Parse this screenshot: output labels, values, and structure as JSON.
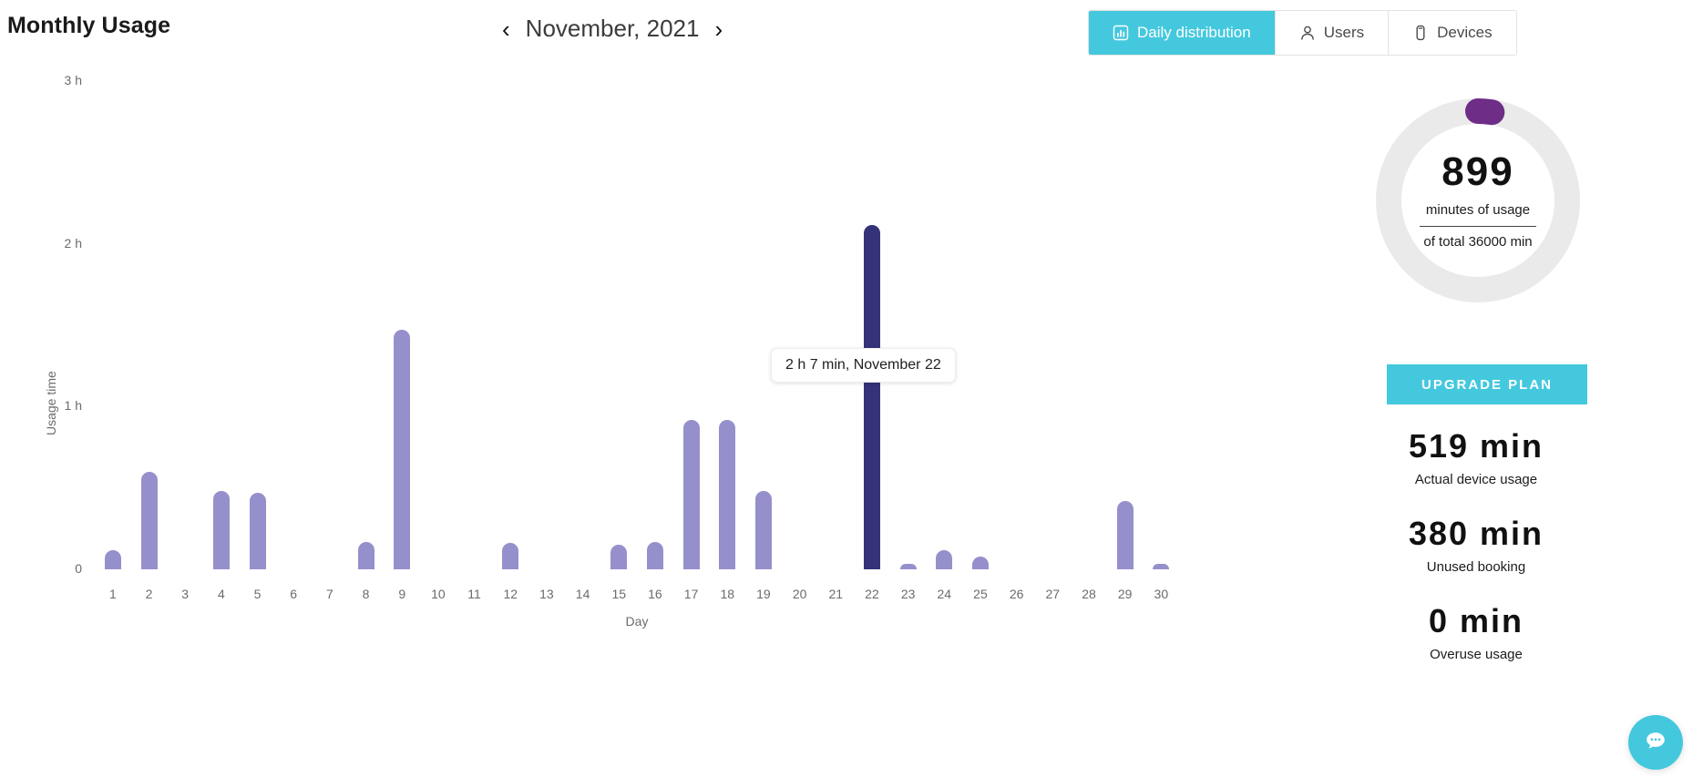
{
  "header": {
    "title": "Monthly Usage",
    "prev_label": "‹",
    "next_label": "›",
    "month": "November, 2021"
  },
  "tabs": [
    {
      "label": "Daily distribution",
      "icon": "bar-chart-icon",
      "active": true
    },
    {
      "label": "Users",
      "icon": "user-icon",
      "active": false
    },
    {
      "label": "Devices",
      "icon": "device-icon",
      "active": false
    }
  ],
  "tooltip": {
    "text": "2 h 7 min, November 22"
  },
  "summary": {
    "value": "899",
    "value_caption": "minutes of usage",
    "total_caption": "of total 36000 min",
    "upgrade_label": "UPGRADE PLAN",
    "stats": [
      {
        "value": "519 min",
        "caption": "Actual device usage"
      },
      {
        "value": "380 min",
        "caption": "Unused booking"
      },
      {
        "value": "0 min",
        "caption": "Overuse usage"
      }
    ]
  },
  "fab": {
    "icon": "chat-bubble-icon"
  },
  "colors": {
    "accent": "#44c8dd",
    "bar": "#9590cb",
    "bar_selected": "#343278",
    "donut_arc": "#6e2d87",
    "donut_track": "#eaeaea"
  },
  "chart_data": {
    "type": "bar",
    "title": "Monthly Usage",
    "xlabel": "Day",
    "ylabel": "Usage time",
    "categories": [
      "1",
      "2",
      "3",
      "4",
      "5",
      "6",
      "7",
      "8",
      "9",
      "10",
      "11",
      "12",
      "13",
      "14",
      "15",
      "16",
      "17",
      "18",
      "19",
      "20",
      "21",
      "22",
      "23",
      "24",
      "25",
      "26",
      "27",
      "28",
      "29",
      "30"
    ],
    "values": [
      0.12,
      0.6,
      0,
      0.48,
      0.47,
      0,
      0,
      0.17,
      1.47,
      0,
      0,
      0.16,
      0,
      0,
      0.15,
      0.17,
      0.92,
      0.92,
      0.48,
      0,
      0,
      2.117,
      0.03,
      0.12,
      0.08,
      0,
      0,
      0,
      0.42,
      0.02
    ],
    "selected_index": 21,
    "unit": "hours",
    "ylim": [
      0,
      3.05
    ],
    "yticks": [
      0,
      1,
      2,
      3
    ],
    "ytick_labels": [
      "0",
      "1 h",
      "2 h",
      "3 h"
    ],
    "grid": false,
    "legend": false
  }
}
